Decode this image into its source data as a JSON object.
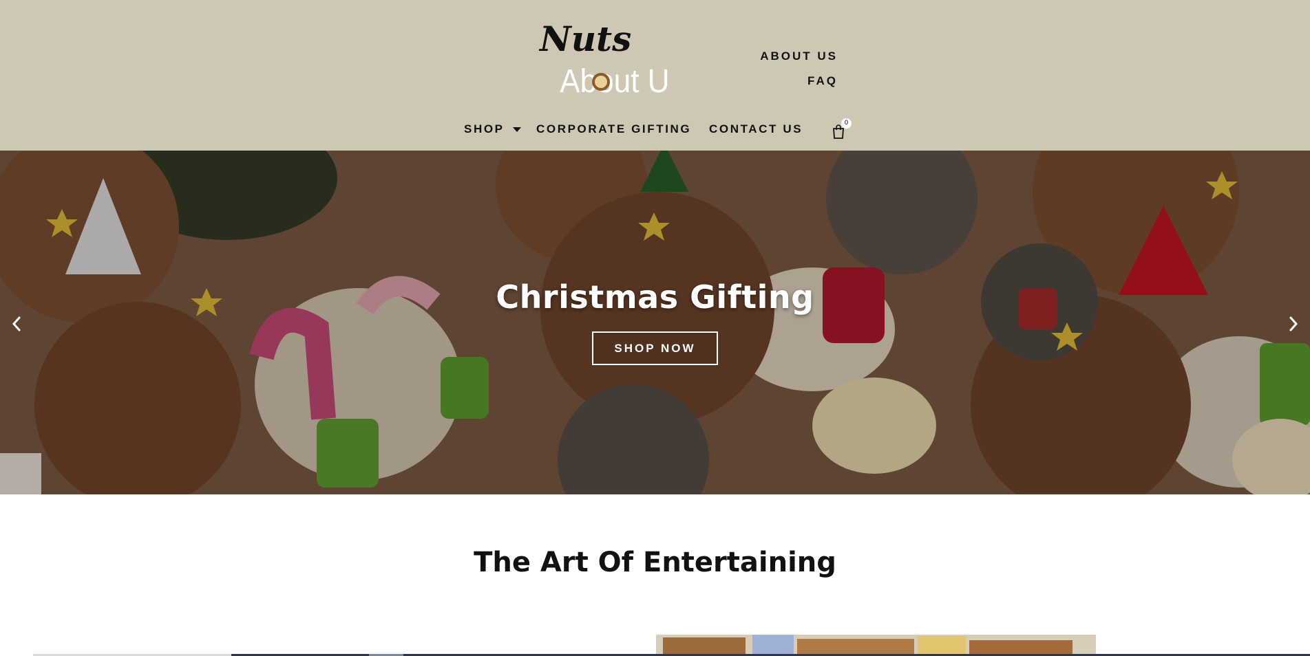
{
  "brand": {
    "logo_line1": "Nuts",
    "logo_line2": "About U"
  },
  "header": {
    "top_links": [
      "ABOUT US",
      "FAQ"
    ],
    "nav": {
      "shop": "SHOP",
      "corporate_gifting": "CORPORATE GIFTING",
      "contact_us": "CONTACT US"
    },
    "cart_count": "0",
    "icons": {
      "cart": "shopping-bag-icon",
      "shop_dropdown": "caret-down-icon"
    }
  },
  "hero": {
    "title": "Christmas Gifting",
    "button": "SHOP NOW",
    "icons": {
      "prev": "chevron-left-icon",
      "next": "chevron-right-icon"
    }
  },
  "sections": {
    "entertaining_title": "The Art Of Entertaining"
  },
  "colors": {
    "header_bg": "#cdc7b3",
    "text": "#111111",
    "hero_text": "#ffffff"
  }
}
